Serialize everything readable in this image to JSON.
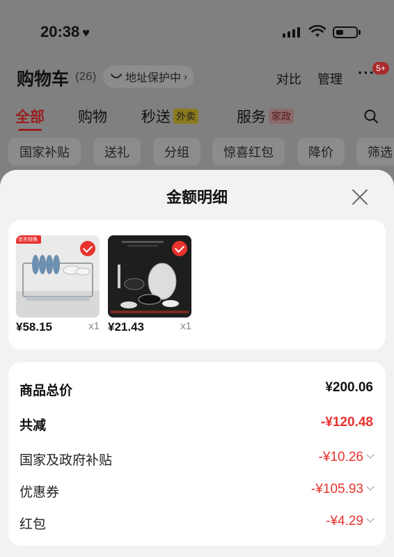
{
  "status_bar": {
    "time": "20:38"
  },
  "header": {
    "title": "购物车",
    "count": "(26)",
    "address_protect": "地址保护中",
    "compare": "对比",
    "manage": "管理",
    "more_badge": "5+"
  },
  "tabs": [
    {
      "label": "全部"
    },
    {
      "label": "购物"
    },
    {
      "label": "秒送",
      "tag": "外卖"
    },
    {
      "label": "服务",
      "tag": "家政"
    }
  ],
  "chips": [
    "国家补贴",
    "送礼",
    "分组",
    "惊喜红包",
    "降价",
    "筛选"
  ],
  "sheet": {
    "title": "金额明细",
    "items": [
      {
        "price": "¥58.15",
        "qty": "x1",
        "thumb_label": "京东特殊"
      },
      {
        "price": "¥21.43",
        "qty": "x1",
        "thumb_label": ""
      }
    ],
    "summary": {
      "total_label": "商品总价",
      "total_value": "¥200.06",
      "discount_label": "共减",
      "discount_value": "-¥120.48",
      "subsidy_label": "国家及政府补贴",
      "subsidy_value": "-¥10.26",
      "coupon_label": "优惠券",
      "coupon_value": "-¥105.93",
      "redpacket_label": "红包",
      "redpacket_value": "-¥4.29"
    }
  },
  "colors": {
    "accent_red": "#e8332f",
    "overlay": "#808080"
  }
}
